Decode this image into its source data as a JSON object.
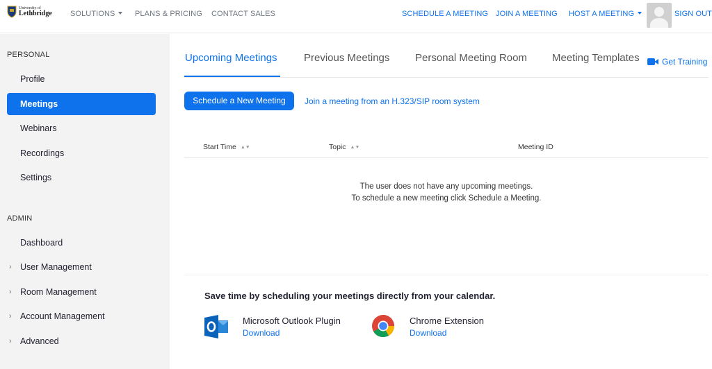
{
  "header": {
    "logo_line1": "University of",
    "logo_line2": "Lethbridge",
    "nav": {
      "solutions": "SOLUTIONS",
      "plans": "PLANS & PRICING",
      "contact": "CONTACT SALES",
      "schedule": "SCHEDULE A MEETING",
      "join": "JOIN A MEETING",
      "host": "HOST A MEETING",
      "signout": "SIGN OUT"
    }
  },
  "sidebar": {
    "personal_title": "PERSONAL",
    "personal_items": [
      "Profile",
      "Meetings",
      "Webinars",
      "Recordings",
      "Settings"
    ],
    "active_item": "Meetings",
    "admin_title": "ADMIN",
    "admin_items": [
      "Dashboard",
      "User Management",
      "Room Management",
      "Account Management",
      "Advanced"
    ]
  },
  "tabs": {
    "upcoming": "Upcoming Meetings",
    "previous": "Previous Meetings",
    "personal_room": "Personal Meeting Room",
    "templates": "Meeting Templates",
    "active": "Upcoming Meetings"
  },
  "get_training": "Get Training",
  "actions": {
    "schedule_button": "Schedule a New Meeting",
    "join_link": "Join a meeting from an H.323/SIP room system"
  },
  "table": {
    "col_start": "Start Time",
    "col_topic": "Topic",
    "col_id": "Meeting ID",
    "empty_line1": "The user does not have any upcoming meetings.",
    "empty_line2": "To schedule a new meeting click Schedule a Meeting."
  },
  "calendar": {
    "title": "Save time by scheduling your meetings directly from your calendar.",
    "outlook_name": "Microsoft Outlook Plugin",
    "outlook_download": "Download",
    "chrome_name": "Chrome Extension",
    "chrome_download": "Download"
  },
  "colors": {
    "accent": "#0e72ed",
    "sidebar_bg": "#f3f3f3"
  }
}
